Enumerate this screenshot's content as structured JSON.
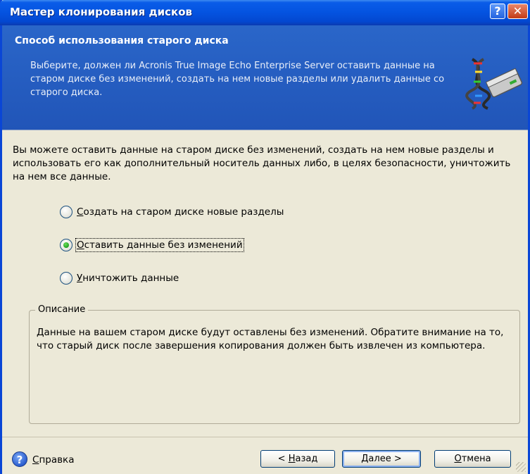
{
  "window": {
    "title": "Мастер клонирования дисков",
    "help_button": "?",
    "close_button": "✕"
  },
  "header": {
    "title": "Способ использования старого диска",
    "description": "Выберите, должен ли Acronis True Image Echo Enterprise Server оставить данные на старом диске без изменений, создать на нем новые разделы или удалить данные со старого диска."
  },
  "main": {
    "intro": "Вы можете оставить данные на старом диске без изменений, создать на нем новые разделы и использовать его как дополнительный носитель данных либо, в целях безопасности, уничтожить на нем все данные.",
    "options": [
      {
        "accel": "С",
        "rest": "оздать на старом диске новые разделы",
        "checked": false
      },
      {
        "accel": "О",
        "rest": "ставить данные без изменений",
        "checked": true
      },
      {
        "accel": "У",
        "rest": "ничтожить данные",
        "checked": false
      }
    ],
    "description_group": {
      "legend": "Описание",
      "text": "Данные на вашем старом диске будут оставлены без изменений. Обратите внимание на то, что старый диск после завершения копирования должен быть извлечен из компьютера."
    }
  },
  "footer": {
    "help_icon": "?",
    "help": {
      "accel": "С",
      "rest": "правка"
    },
    "back": {
      "prefix": "< ",
      "accel": "Н",
      "rest": "азад"
    },
    "next": {
      "accel": "Д",
      "rest": "алее >"
    },
    "cancel": {
      "accel": "О",
      "rest": "тмена"
    }
  },
  "colors": {
    "titlebar": "#0453e0",
    "header_bg": "#2a66c9",
    "window_bg": "#ece9d8",
    "radio_checked": "#21a121"
  }
}
